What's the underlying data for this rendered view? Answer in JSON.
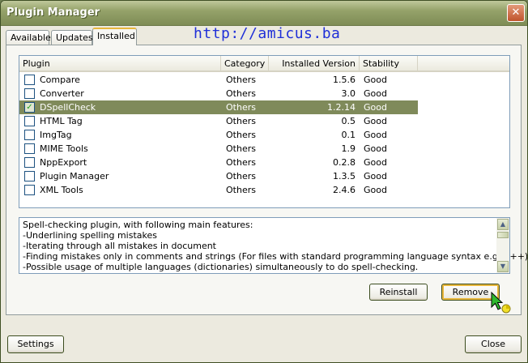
{
  "window": {
    "title": "Plugin Manager",
    "close_glyph": "✕"
  },
  "tabs": [
    {
      "label": "Available"
    },
    {
      "label": "Updates"
    },
    {
      "label": "Installed"
    }
  ],
  "watermark": "http://amicus.ba",
  "list": {
    "columns": [
      "Plugin",
      "Category",
      "Installed Version",
      "Stability"
    ],
    "rows": [
      {
        "name": "Compare",
        "category": "Others",
        "version": "1.5.6",
        "stability": "Good",
        "checked": false,
        "selected": false
      },
      {
        "name": "Converter",
        "category": "Others",
        "version": "3.0",
        "stability": "Good",
        "checked": false,
        "selected": false
      },
      {
        "name": "DSpellCheck",
        "category": "Others",
        "version": "1.2.14",
        "stability": "Good",
        "checked": true,
        "selected": true
      },
      {
        "name": "HTML Tag",
        "category": "Others",
        "version": "0.5",
        "stability": "Good",
        "checked": false,
        "selected": false
      },
      {
        "name": "ImgTag",
        "category": "Others",
        "version": "0.1",
        "stability": "Good",
        "checked": false,
        "selected": false
      },
      {
        "name": "MIME Tools",
        "category": "Others",
        "version": "1.9",
        "stability": "Good",
        "checked": false,
        "selected": false
      },
      {
        "name": "NppExport",
        "category": "Others",
        "version": "0.2.8",
        "stability": "Good",
        "checked": false,
        "selected": false
      },
      {
        "name": "Plugin Manager",
        "category": "Others",
        "version": "1.3.5",
        "stability": "Good",
        "checked": false,
        "selected": false
      },
      {
        "name": "XML Tools",
        "category": "Others",
        "version": "2.4.6",
        "stability": "Good",
        "checked": false,
        "selected": false
      }
    ]
  },
  "description": {
    "lines": [
      "Spell-checking plugin, with following main features:",
      "-Underlining spelling mistakes",
      "-Iterating through all mistakes in document",
      "-Finding mistakes only in comments and strings (For files with standard programming language syntax e.g. C++)",
      "-Possible usage of multiple languages (dictionaries) simultaneously to do spell-checking."
    ]
  },
  "buttons": {
    "reinstall": "Reinstall",
    "remove": "Remove",
    "settings": "Settings",
    "close": "Close"
  },
  "icons": {
    "checkbox": "checkbox-icon",
    "scroll_up": "scroll-up-icon",
    "scroll_down": "scroll-down-icon",
    "cursor": "pointer-busy-cursor-icon"
  },
  "colors": {
    "title_bar": "#95a26a",
    "selection": "#7f8a5a",
    "tab_highlight": "#e9b73c",
    "watermark": "#1f2fd8"
  }
}
